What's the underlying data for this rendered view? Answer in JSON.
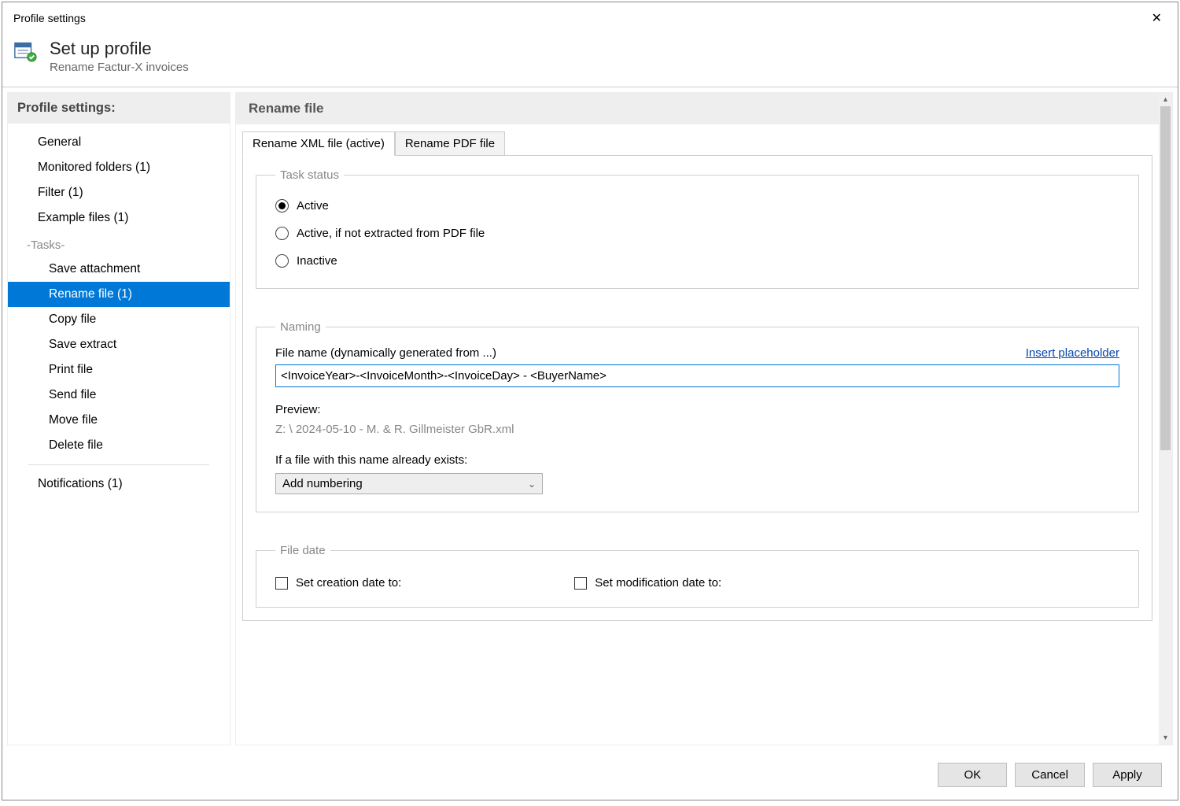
{
  "window": {
    "title": "Profile settings"
  },
  "header": {
    "title": "Set up profile",
    "subtitle": "Rename Factur-X invoices"
  },
  "sidebar": {
    "title": "Profile settings:",
    "items": [
      {
        "label": "General"
      },
      {
        "label": "Monitored folders (1)"
      },
      {
        "label": "Filter (1)"
      },
      {
        "label": "Example files (1)"
      }
    ],
    "tasks_group": "-Tasks-",
    "tasks": [
      {
        "label": "Save attachment"
      },
      {
        "label": "Rename file (1)",
        "active": true
      },
      {
        "label": "Copy file"
      },
      {
        "label": "Save extract"
      },
      {
        "label": "Print file"
      },
      {
        "label": "Send file"
      },
      {
        "label": "Move file"
      },
      {
        "label": "Delete file"
      }
    ],
    "footer_item": "Notifications (1)"
  },
  "main": {
    "title": "Rename file",
    "tabs": [
      {
        "label": "Rename XML file (active)",
        "active": true
      },
      {
        "label": "Rename PDF file"
      }
    ],
    "task_status": {
      "legend": "Task status",
      "options": [
        {
          "label": "Active",
          "selected": true
        },
        {
          "label": "Active, if not extracted from PDF file"
        },
        {
          "label": "Inactive"
        }
      ]
    },
    "naming": {
      "legend": "Naming",
      "filename_label": "File name (dynamically generated from ...)",
      "insert_placeholder": "Insert placeholder",
      "filename_value": "<InvoiceYear>-<InvoiceMonth>-<InvoiceDay> - <BuyerName>",
      "preview_label": "Preview:",
      "preview_value": "Z: \\ 2024-05-10 - M. & R. Gillmeister GbR.xml",
      "exists_label": "If a file with this name already exists:",
      "exists_value": "Add numbering"
    },
    "file_date": {
      "legend": "File date",
      "creation_label": "Set creation date to:",
      "modification_label": "Set modification date to:"
    }
  },
  "footer": {
    "ok": "OK",
    "cancel": "Cancel",
    "apply": "Apply"
  }
}
